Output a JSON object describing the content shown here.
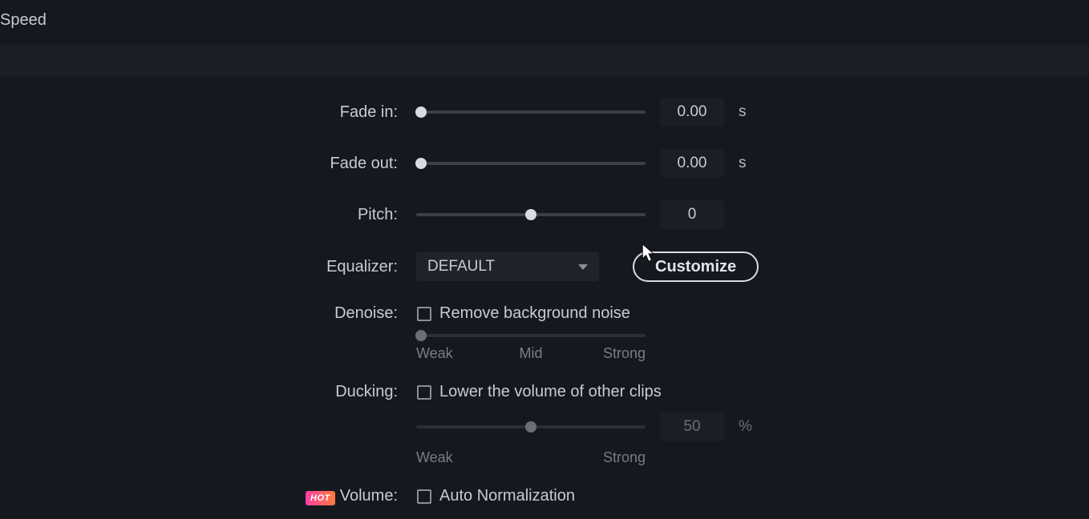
{
  "header": {
    "tab": "Speed"
  },
  "fadeIn": {
    "label": "Fade in:",
    "value": "0.00",
    "unit": "s",
    "thumbPct": 0
  },
  "fadeOut": {
    "label": "Fade out:",
    "value": "0.00",
    "unit": "s",
    "thumbPct": 0
  },
  "pitch": {
    "label": "Pitch:",
    "value": "0",
    "thumbPct": 50
  },
  "equalizer": {
    "label": "Equalizer:",
    "selected": "DEFAULT",
    "customizeLabel": "Customize"
  },
  "denoise": {
    "label": "Denoise:",
    "checkLabel": "Remove background noise",
    "weak": "Weak",
    "mid": "Mid",
    "strong": "Strong",
    "thumbPct": 0
  },
  "ducking": {
    "label": "Ducking:",
    "checkLabel": "Lower the volume of other clips",
    "value": "50",
    "unit": "%",
    "weak": "Weak",
    "strong": "Strong",
    "thumbPct": 50
  },
  "volume": {
    "badge": "HOT",
    "label": "Volume:",
    "checkLabel": "Auto Normalization"
  }
}
